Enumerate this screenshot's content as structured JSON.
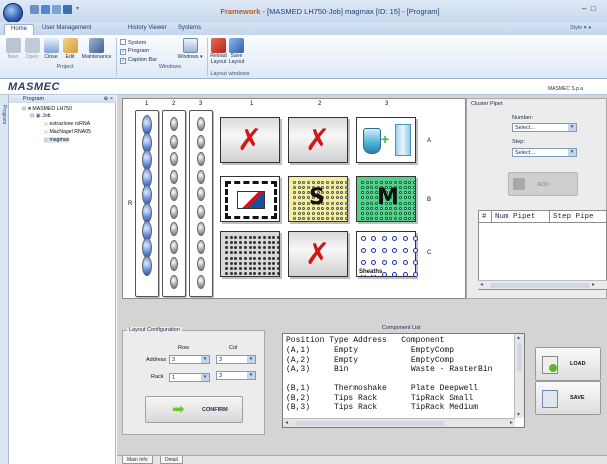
{
  "window": {
    "app_name": "Framework",
    "title_rest": " - [MASMED LH750-Job] magmax [ID: 15] - [Program]",
    "style_label": "Style"
  },
  "tabs": [
    "Home",
    "User Management",
    "History Viewer",
    "Systems"
  ],
  "ribbon": {
    "project": {
      "label": "Project",
      "buttons": [
        "New",
        "Open",
        "Close",
        "Edit",
        "Maintenance"
      ]
    },
    "windows": {
      "label": "Windows",
      "checks": [
        {
          "label": "System",
          "checked": false
        },
        {
          "label": "Program",
          "checked": true
        },
        {
          "label": "Caption Bar",
          "checked": true
        }
      ],
      "button": "Windows"
    },
    "layout_windows": {
      "label": "Layout windows",
      "buttons": [
        "Reload\nLayout",
        "Save\nLayout"
      ]
    }
  },
  "brand": {
    "logo": "MASMEC",
    "company": "MASMEC S.p.a"
  },
  "left_tab": "Program",
  "tree": {
    "header": "Program",
    "pin": "⊕ ×",
    "nodes": [
      {
        "label": "MASMED LH750",
        "level": 0
      },
      {
        "label": "Job",
        "level": 1
      },
      {
        "label": "estrazione rsRNA",
        "level": 2
      },
      {
        "label": "MacNagel RNA05",
        "level": 2
      },
      {
        "label": "magmax",
        "level": 2
      }
    ]
  },
  "deck": {
    "strip_cols": [
      "1",
      "2",
      "3"
    ],
    "cell_cols": [
      "1",
      "2",
      "3"
    ],
    "rows": [
      "A",
      "B",
      "C"
    ],
    "strip_row": "R",
    "cells": [
      {
        "pos": "A,1",
        "kind": "empty"
      },
      {
        "pos": "A,2",
        "kind": "empty"
      },
      {
        "pos": "A,3",
        "kind": "bin"
      },
      {
        "pos": "B,1",
        "kind": "thermoshake"
      },
      {
        "pos": "B,2",
        "kind": "tips-small",
        "mark": "S"
      },
      {
        "pos": "B,3",
        "kind": "tips-medium",
        "mark": "M"
      },
      {
        "pos": "C,1",
        "kind": "deepwell"
      },
      {
        "pos": "C,2",
        "kind": "empty"
      },
      {
        "pos": "C,3",
        "kind": "sheaths",
        "caption": "Sheaths"
      }
    ]
  },
  "cluster_pipet": {
    "title": "Cluster Pipet",
    "number_label": "Number:",
    "number_value": "Select...",
    "step_label": "Step:",
    "step_value": "Select...",
    "add_label": "ADD",
    "table_headers": [
      "#",
      "Num Pipet",
      "Step Pipe"
    ]
  },
  "layout_config": {
    "title": "Layout Configuration",
    "row_label": "Row",
    "col_label": "Col",
    "address_label": "Address",
    "address_row": "3",
    "address_col": "3",
    "rack_label": "Rack",
    "rack_row": "1",
    "rack_col": "3",
    "confirm_label": "CONFIRM"
  },
  "component_list": {
    "title": "Component List",
    "headers": [
      "Position",
      "Type Address",
      "Component"
    ],
    "rows": [
      [
        "(A,1)",
        "Empty",
        "EmptyComp"
      ],
      [
        "(A,2)",
        "Empty",
        "EmptyComp"
      ],
      [
        "(A,3)",
        "Bin",
        "Waste - RasterBin"
      ],
      [
        "",
        "",
        ""
      ],
      [
        "(B,1)",
        "Thermoshake",
        "Plate Deepwell"
      ],
      [
        "(B,2)",
        "Tips Rack",
        "TipRack Small"
      ],
      [
        "(B,3)",
        "Tips Rack",
        "TipRack Medium"
      ]
    ]
  },
  "side_buttons": {
    "load": "LOAD",
    "save": "SAVE"
  },
  "bottom_tabs": [
    "Main Info",
    "Detail"
  ]
}
